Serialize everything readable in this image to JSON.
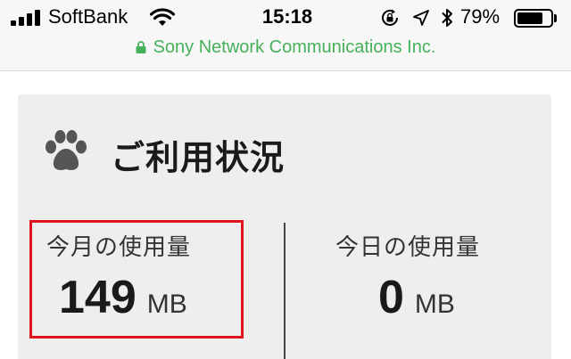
{
  "status_bar": {
    "carrier": "SoftBank",
    "time": "15:18",
    "battery_percent": "79%",
    "battery_level": 0.79,
    "icons": [
      "signal-icon",
      "wifi-icon",
      "rotation-lock-icon",
      "location-icon",
      "bluetooth-icon",
      "battery-icon"
    ],
    "certificate": "Sony Network Communications Inc."
  },
  "usage_card": {
    "icon": "paw-icon",
    "title": "ご利用状況",
    "monthly": {
      "label": "今月の使用量",
      "value": "149",
      "unit": "MB"
    },
    "daily": {
      "label": "今日の使用量",
      "value": "0",
      "unit": "MB"
    }
  },
  "colors": {
    "certificate_green": "#46b15a",
    "highlight_red": "#e0141e",
    "card_background": "#eeeeee"
  }
}
